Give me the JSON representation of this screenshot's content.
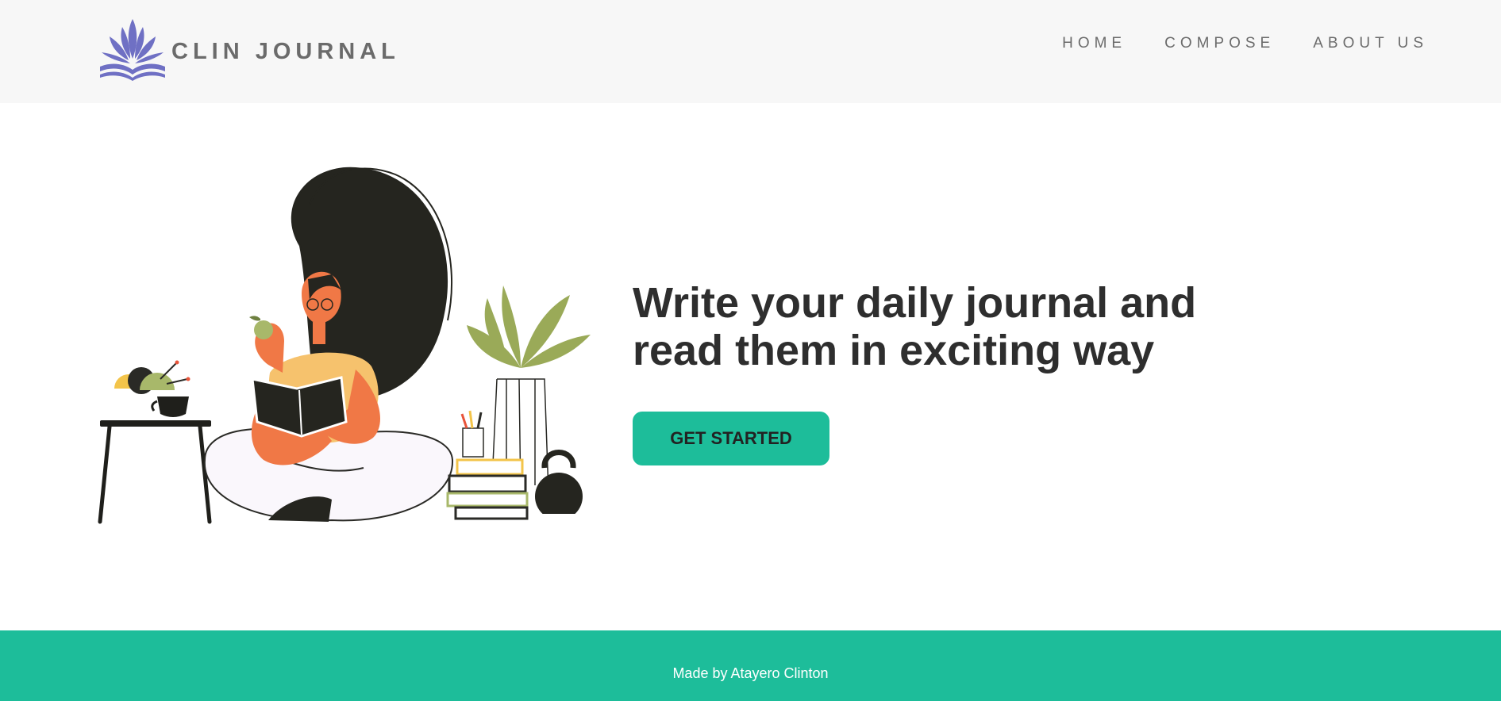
{
  "colors": {
    "accent": "#1dbd9a",
    "header_bg": "#f7f7f7",
    "text_gray": "#6b6b6b",
    "headline": "#2e2e2e",
    "logo": "#6f70c4"
  },
  "header": {
    "brand": "CLIN JOURNAL",
    "logo_icon": "lotus-book-icon",
    "nav": [
      {
        "label": "HOME"
      },
      {
        "label": "COMPOSE"
      },
      {
        "label": "ABOUT US"
      }
    ]
  },
  "hero": {
    "illustration": "woman-reading-book-illustration",
    "headline": "Write your daily journal and read them in exciting way",
    "cta_label": "GET STARTED"
  },
  "footer": {
    "text": "Made by Atayero Clinton"
  }
}
